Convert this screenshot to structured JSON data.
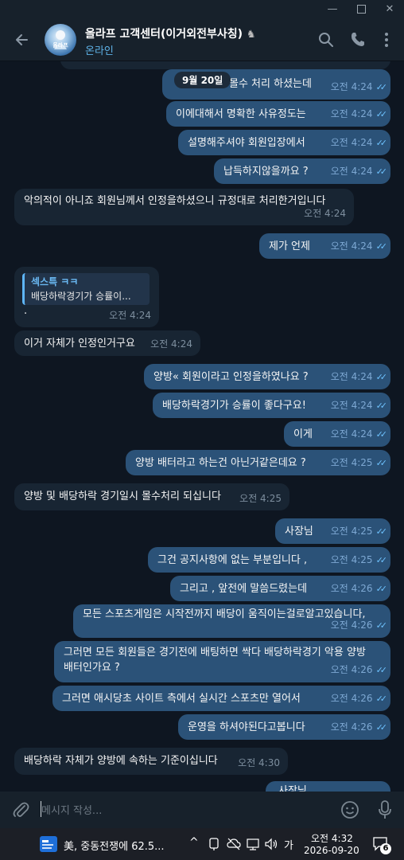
{
  "window": {
    "min_icon": "minimize-icon",
    "max_icon": "maximize-icon",
    "close_icon": "close-icon"
  },
  "header": {
    "title": "올라프 고객센터(이거외전부사칭)",
    "status": "온라인",
    "avatar_text": "올라프",
    "icons": [
      "back-arrow-icon",
      "search-icon",
      "phone-icon",
      "more-vertical-icon"
    ]
  },
  "chat": {
    "date_pill": "9월 20일",
    "partial_top_text": "몰수 처리 하셨는데",
    "partial_top_time": "오전",
    "messages": [
      {
        "text": "이에대해서 명확한 사유정도는",
        "time": "오전 4:24"
      },
      {
        "text": "설명해주셔야 회원입장에서",
        "time": "오전 4:24"
      },
      {
        "text": "납득하지않을까요 ?",
        "time": "오전 4:24"
      },
      {
        "text": "악의적이 아니죠 회원님께서 인정을하셨으니 규정대로 처리한거입니다",
        "time": "오전 4:24"
      },
      {
        "text": "제가 언제",
        "time": "오전 4:24"
      },
      {
        "quote_name": "섹스특 ㅋㅋ",
        "quote_text": "배당하락경기가 승률이...",
        "text": "·",
        "time": "오전 4:24"
      },
      {
        "text": "이거 자체가 인정인거구요",
        "time": "오전 4:24"
      },
      {
        "text": "양방« 회원이라고 인정을하였나요 ?",
        "time": "오전 4:24"
      },
      {
        "text": "배당하락경기가 승률이 좋다구요!",
        "time": "오전 4:24"
      },
      {
        "text": "이게",
        "time": "오전 4:24"
      },
      {
        "text": "양방 배터라고 하는건 아닌거같은데요 ?",
        "time": "오전 4:25"
      },
      {
        "text": "양방 및 배당하락 경기일시 몰수처리 되십니다",
        "time": "오전 4:25"
      },
      {
        "text": "사장님",
        "time": "오전 4:25"
      },
      {
        "text": "그건 공지사항에 없는 부분입니다 ,",
        "time": "오전 4:25"
      },
      {
        "text": "그리고 , 앞전에 말씀드렸는데",
        "time": "오전 4:26"
      },
      {
        "text": "모든 스포츠게임은 시작전까지 배당이 움직이는걸로알고있습니다,",
        "time": "오전 4:26"
      },
      {
        "line1": "그러면 모든 회원들은 경기전에 배팅하면 싹다 배당하락경기 악용 양방",
        "line2": "배터인가요 ?",
        "time": "오전 4:26"
      },
      {
        "text": "그러면 애시당초 사이트 측에서 실시간 스포츠만 열어서",
        "time": "오전 4:26"
      },
      {
        "text": "운영을 하셔야된다고봅니다",
        "time": "오전 4:26"
      },
      {
        "text": "배당하락 자체가 양방에 속하는 기준이십니다",
        "time": "오전 4:30"
      },
      {
        "text": "사장님",
        "time": ""
      }
    ]
  },
  "composer": {
    "placeholder": "메시지 작성...",
    "icons": [
      "attach-icon",
      "emoji-icon",
      "mic-icon"
    ]
  },
  "taskbar": {
    "news_text": "美, 중동전쟁에 62.5...",
    "ime_text": "가",
    "time": "오전 4:32",
    "date": "2026-09-20",
    "notification_count": "6"
  }
}
